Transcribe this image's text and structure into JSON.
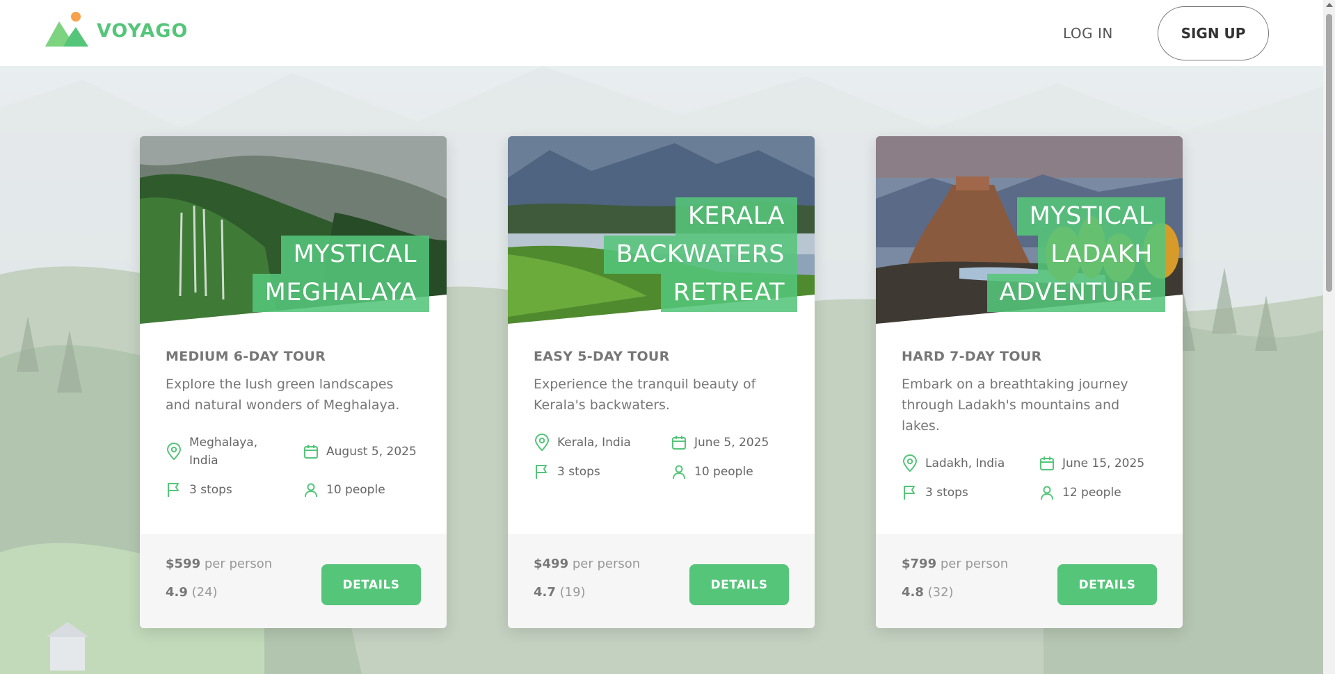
{
  "brand": {
    "name": "VOYAGO",
    "accent": "#55c57a"
  },
  "nav": {
    "login": "LOG IN",
    "signup": "SIGN UP"
  },
  "tours": [
    {
      "title_lines": [
        "MYSTICAL",
        "MEGHALAYA"
      ],
      "meta": "MEDIUM 6-DAY TOUR",
      "description": "Explore the lush green landscapes and natural wonders of Meghalaya.",
      "location": "Meghalaya, India",
      "date": "August 5, 2025",
      "stops": "3 stops",
      "people": "10 people",
      "price": "$599",
      "price_unit": "per person",
      "rating": "4.9",
      "rating_count": "(24)",
      "button": "DETAILS"
    },
    {
      "title_lines": [
        "KERALA",
        "BACKWATERS",
        "RETREAT"
      ],
      "meta": "EASY 5-DAY TOUR",
      "description": "Experience the tranquil beauty of Kerala's backwaters.",
      "location": "Kerala, India",
      "date": "June 5, 2025",
      "stops": "3 stops",
      "people": "10 people",
      "price": "$499",
      "price_unit": "per person",
      "rating": "4.7",
      "rating_count": "(19)",
      "button": "DETAILS"
    },
    {
      "title_lines": [
        "MYSTICAL",
        "LADAKH",
        "ADVENTURE"
      ],
      "meta": "HARD 7-DAY TOUR",
      "description": "Embark on a breathtaking journey through Ladakh's mountains and lakes.",
      "location": "Ladakh, India",
      "date": "June 15, 2025",
      "stops": "3 stops",
      "people": "12 people",
      "price": "$799",
      "price_unit": "per person",
      "rating": "4.8",
      "rating_count": "(32)",
      "button": "DETAILS"
    }
  ],
  "icons": {
    "location": "map-pin-icon",
    "date": "calendar-icon",
    "stops": "flag-icon",
    "people": "user-icon"
  }
}
